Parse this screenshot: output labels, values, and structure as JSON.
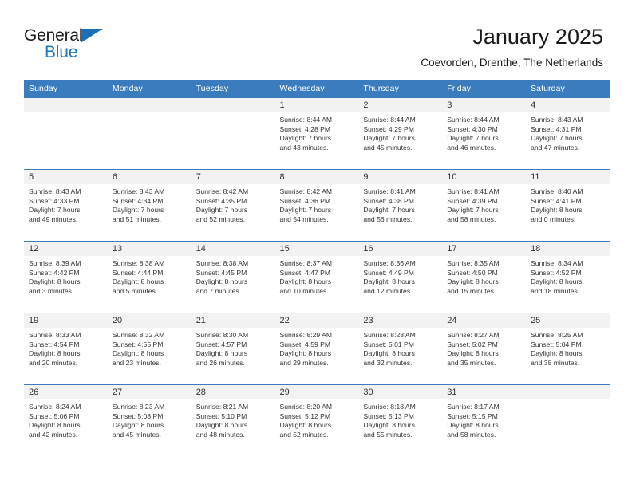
{
  "brand": {
    "name_top": "General",
    "name_bottom": "Blue",
    "color_dark": "#1b1b1b",
    "color_blue": "#1f77c4",
    "triangle_color": "#1a6fb5"
  },
  "header": {
    "title": "January 2025",
    "subtitle": "Coevorden, Drenthe, The Netherlands"
  },
  "theme": {
    "header_bg": "#3a7cbe",
    "header_text": "#ffffff",
    "daynum_bg": "#f2f2f2",
    "cell_text": "#333333",
    "grid_line": "#3a7cbe"
  },
  "weekdays": [
    "Sunday",
    "Monday",
    "Tuesday",
    "Wednesday",
    "Thursday",
    "Friday",
    "Saturday"
  ],
  "weeks": [
    [
      {
        "day": "",
        "sunrise": "",
        "sunset": "",
        "daylight_line1": "",
        "daylight_line2": "",
        "empty": true
      },
      {
        "day": "",
        "sunrise": "",
        "sunset": "",
        "daylight_line1": "",
        "daylight_line2": "",
        "empty": true
      },
      {
        "day": "",
        "sunrise": "",
        "sunset": "",
        "daylight_line1": "",
        "daylight_line2": "",
        "empty": true
      },
      {
        "day": "1",
        "sunrise": "Sunrise: 8:44 AM",
        "sunset": "Sunset: 4:28 PM",
        "daylight_line1": "Daylight: 7 hours",
        "daylight_line2": "and 43 minutes.",
        "empty": false
      },
      {
        "day": "2",
        "sunrise": "Sunrise: 8:44 AM",
        "sunset": "Sunset: 4:29 PM",
        "daylight_line1": "Daylight: 7 hours",
        "daylight_line2": "and 45 minutes.",
        "empty": false
      },
      {
        "day": "3",
        "sunrise": "Sunrise: 8:44 AM",
        "sunset": "Sunset: 4:30 PM",
        "daylight_line1": "Daylight: 7 hours",
        "daylight_line2": "and 46 minutes.",
        "empty": false
      },
      {
        "day": "4",
        "sunrise": "Sunrise: 8:43 AM",
        "sunset": "Sunset: 4:31 PM",
        "daylight_line1": "Daylight: 7 hours",
        "daylight_line2": "and 47 minutes.",
        "empty": false
      }
    ],
    [
      {
        "day": "5",
        "sunrise": "Sunrise: 8:43 AM",
        "sunset": "Sunset: 4:33 PM",
        "daylight_line1": "Daylight: 7 hours",
        "daylight_line2": "and 49 minutes.",
        "empty": false
      },
      {
        "day": "6",
        "sunrise": "Sunrise: 8:43 AM",
        "sunset": "Sunset: 4:34 PM",
        "daylight_line1": "Daylight: 7 hours",
        "daylight_line2": "and 51 minutes.",
        "empty": false
      },
      {
        "day": "7",
        "sunrise": "Sunrise: 8:42 AM",
        "sunset": "Sunset: 4:35 PM",
        "daylight_line1": "Daylight: 7 hours",
        "daylight_line2": "and 52 minutes.",
        "empty": false
      },
      {
        "day": "8",
        "sunrise": "Sunrise: 8:42 AM",
        "sunset": "Sunset: 4:36 PM",
        "daylight_line1": "Daylight: 7 hours",
        "daylight_line2": "and 54 minutes.",
        "empty": false
      },
      {
        "day": "9",
        "sunrise": "Sunrise: 8:41 AM",
        "sunset": "Sunset: 4:38 PM",
        "daylight_line1": "Daylight: 7 hours",
        "daylight_line2": "and 56 minutes.",
        "empty": false
      },
      {
        "day": "10",
        "sunrise": "Sunrise: 8:41 AM",
        "sunset": "Sunset: 4:39 PM",
        "daylight_line1": "Daylight: 7 hours",
        "daylight_line2": "and 58 minutes.",
        "empty": false
      },
      {
        "day": "11",
        "sunrise": "Sunrise: 8:40 AM",
        "sunset": "Sunset: 4:41 PM",
        "daylight_line1": "Daylight: 8 hours",
        "daylight_line2": "and 0 minutes.",
        "empty": false
      }
    ],
    [
      {
        "day": "12",
        "sunrise": "Sunrise: 8:39 AM",
        "sunset": "Sunset: 4:42 PM",
        "daylight_line1": "Daylight: 8 hours",
        "daylight_line2": "and 3 minutes.",
        "empty": false
      },
      {
        "day": "13",
        "sunrise": "Sunrise: 8:38 AM",
        "sunset": "Sunset: 4:44 PM",
        "daylight_line1": "Daylight: 8 hours",
        "daylight_line2": "and 5 minutes.",
        "empty": false
      },
      {
        "day": "14",
        "sunrise": "Sunrise: 8:38 AM",
        "sunset": "Sunset: 4:45 PM",
        "daylight_line1": "Daylight: 8 hours",
        "daylight_line2": "and 7 minutes.",
        "empty": false
      },
      {
        "day": "15",
        "sunrise": "Sunrise: 8:37 AM",
        "sunset": "Sunset: 4:47 PM",
        "daylight_line1": "Daylight: 8 hours",
        "daylight_line2": "and 10 minutes.",
        "empty": false
      },
      {
        "day": "16",
        "sunrise": "Sunrise: 8:36 AM",
        "sunset": "Sunset: 4:49 PM",
        "daylight_line1": "Daylight: 8 hours",
        "daylight_line2": "and 12 minutes.",
        "empty": false
      },
      {
        "day": "17",
        "sunrise": "Sunrise: 8:35 AM",
        "sunset": "Sunset: 4:50 PM",
        "daylight_line1": "Daylight: 8 hours",
        "daylight_line2": "and 15 minutes.",
        "empty": false
      },
      {
        "day": "18",
        "sunrise": "Sunrise: 8:34 AM",
        "sunset": "Sunset: 4:52 PM",
        "daylight_line1": "Daylight: 8 hours",
        "daylight_line2": "and 18 minutes.",
        "empty": false
      }
    ],
    [
      {
        "day": "19",
        "sunrise": "Sunrise: 8:33 AM",
        "sunset": "Sunset: 4:54 PM",
        "daylight_line1": "Daylight: 8 hours",
        "daylight_line2": "and 20 minutes.",
        "empty": false
      },
      {
        "day": "20",
        "sunrise": "Sunrise: 8:32 AM",
        "sunset": "Sunset: 4:55 PM",
        "daylight_line1": "Daylight: 8 hours",
        "daylight_line2": "and 23 minutes.",
        "empty": false
      },
      {
        "day": "21",
        "sunrise": "Sunrise: 8:30 AM",
        "sunset": "Sunset: 4:57 PM",
        "daylight_line1": "Daylight: 8 hours",
        "daylight_line2": "and 26 minutes.",
        "empty": false
      },
      {
        "day": "22",
        "sunrise": "Sunrise: 8:29 AM",
        "sunset": "Sunset: 4:59 PM",
        "daylight_line1": "Daylight: 8 hours",
        "daylight_line2": "and 29 minutes.",
        "empty": false
      },
      {
        "day": "23",
        "sunrise": "Sunrise: 8:28 AM",
        "sunset": "Sunset: 5:01 PM",
        "daylight_line1": "Daylight: 8 hours",
        "daylight_line2": "and 32 minutes.",
        "empty": false
      },
      {
        "day": "24",
        "sunrise": "Sunrise: 8:27 AM",
        "sunset": "Sunset: 5:02 PM",
        "daylight_line1": "Daylight: 8 hours",
        "daylight_line2": "and 35 minutes.",
        "empty": false
      },
      {
        "day": "25",
        "sunrise": "Sunrise: 8:25 AM",
        "sunset": "Sunset: 5:04 PM",
        "daylight_line1": "Daylight: 8 hours",
        "daylight_line2": "and 38 minutes.",
        "empty": false
      }
    ],
    [
      {
        "day": "26",
        "sunrise": "Sunrise: 8:24 AM",
        "sunset": "Sunset: 5:06 PM",
        "daylight_line1": "Daylight: 8 hours",
        "daylight_line2": "and 42 minutes.",
        "empty": false
      },
      {
        "day": "27",
        "sunrise": "Sunrise: 8:23 AM",
        "sunset": "Sunset: 5:08 PM",
        "daylight_line1": "Daylight: 8 hours",
        "daylight_line2": "and 45 minutes.",
        "empty": false
      },
      {
        "day": "28",
        "sunrise": "Sunrise: 8:21 AM",
        "sunset": "Sunset: 5:10 PM",
        "daylight_line1": "Daylight: 8 hours",
        "daylight_line2": "and 48 minutes.",
        "empty": false
      },
      {
        "day": "29",
        "sunrise": "Sunrise: 8:20 AM",
        "sunset": "Sunset: 5:12 PM",
        "daylight_line1": "Daylight: 8 hours",
        "daylight_line2": "and 52 minutes.",
        "empty": false
      },
      {
        "day": "30",
        "sunrise": "Sunrise: 8:18 AM",
        "sunset": "Sunset: 5:13 PM",
        "daylight_line1": "Daylight: 8 hours",
        "daylight_line2": "and 55 minutes.",
        "empty": false
      },
      {
        "day": "31",
        "sunrise": "Sunrise: 8:17 AM",
        "sunset": "Sunset: 5:15 PM",
        "daylight_line1": "Daylight: 8 hours",
        "daylight_line2": "and 58 minutes.",
        "empty": false
      },
      {
        "day": "",
        "sunrise": "",
        "sunset": "",
        "daylight_line1": "",
        "daylight_line2": "",
        "empty": true
      }
    ]
  ]
}
